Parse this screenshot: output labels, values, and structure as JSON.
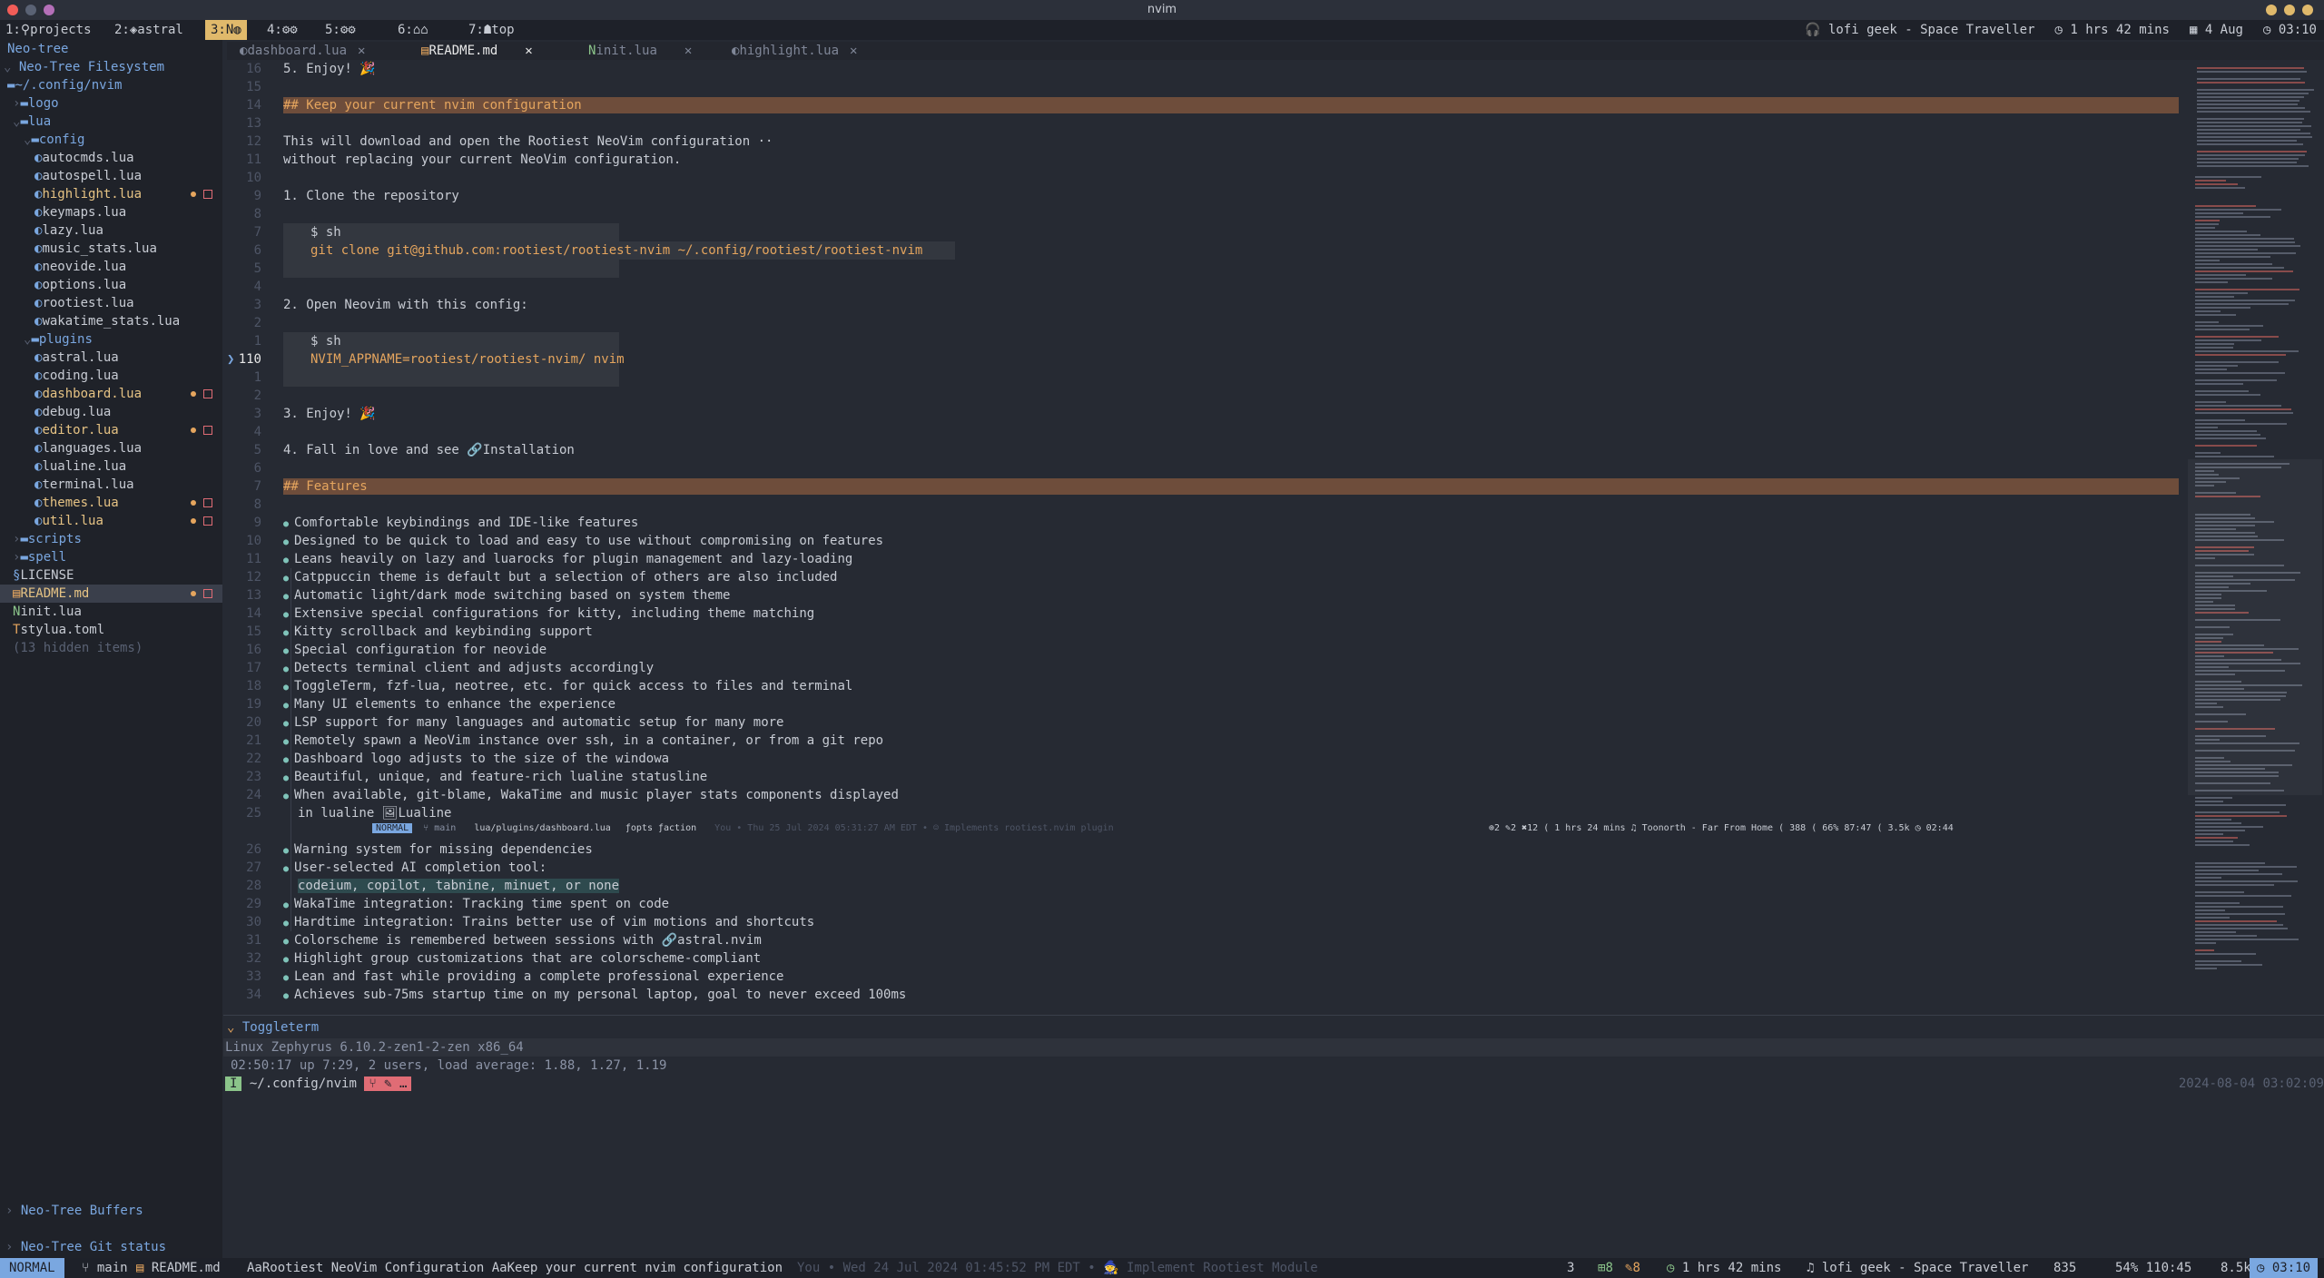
{
  "window": {
    "title": "nvim"
  },
  "workspaces": [
    {
      "label": "1:⚲projects",
      "active": false
    },
    {
      "label": "2:◈astral",
      "active": false
    },
    {
      "label": "3:N◍",
      "active": true
    },
    {
      "label": "4:⚙⚙",
      "active": false
    },
    {
      "label": "5:⚙⚙",
      "active": false
    },
    {
      "label": "6:⌂⌂",
      "active": false
    },
    {
      "label": "7:☗top",
      "active": false
    }
  ],
  "topright": {
    "music": "lofi geek - Space Traveller",
    "timer": "1 hrs 42 mins",
    "date": "4 Aug",
    "time": "03:10"
  },
  "neotree": {
    "header": "Neo-tree",
    "title": "Neo-Tree Filesystem",
    "root": "~/.config/nvim",
    "items": [
      {
        "label": "logo",
        "kind": "folder",
        "indent": 1,
        "open": false
      },
      {
        "label": "lua",
        "kind": "folder",
        "indent": 1,
        "open": true
      },
      {
        "label": "config",
        "kind": "folder",
        "indent": 2,
        "open": true
      },
      {
        "label": "autocmds.lua",
        "kind": "lua",
        "indent": 3
      },
      {
        "label": "autospell.lua",
        "kind": "lua",
        "indent": 3
      },
      {
        "label": "highlight.lua",
        "kind": "lua",
        "indent": 3,
        "modified": true
      },
      {
        "label": "keymaps.lua",
        "kind": "lua",
        "indent": 3
      },
      {
        "label": "lazy.lua",
        "kind": "lua",
        "indent": 3
      },
      {
        "label": "music_stats.lua",
        "kind": "lua",
        "indent": 3
      },
      {
        "label": "neovide.lua",
        "kind": "lua",
        "indent": 3
      },
      {
        "label": "options.lua",
        "kind": "lua",
        "indent": 3
      },
      {
        "label": "rootiest.lua",
        "kind": "lua",
        "indent": 3
      },
      {
        "label": "wakatime_stats.lua",
        "kind": "lua",
        "indent": 3
      },
      {
        "label": "plugins",
        "kind": "folder",
        "indent": 2,
        "open": true
      },
      {
        "label": "astral.lua",
        "kind": "lua",
        "indent": 3
      },
      {
        "label": "coding.lua",
        "kind": "lua",
        "indent": 3
      },
      {
        "label": "dashboard.lua",
        "kind": "lua",
        "indent": 3,
        "modified": true
      },
      {
        "label": "debug.lua",
        "kind": "lua",
        "indent": 3
      },
      {
        "label": "editor.lua",
        "kind": "lua",
        "indent": 3,
        "modified": true
      },
      {
        "label": "languages.lua",
        "kind": "lua",
        "indent": 3
      },
      {
        "label": "lualine.lua",
        "kind": "lua",
        "indent": 3
      },
      {
        "label": "terminal.lua",
        "kind": "lua",
        "indent": 3
      },
      {
        "label": "themes.lua",
        "kind": "lua",
        "indent": 3,
        "modified": true
      },
      {
        "label": "util.lua",
        "kind": "lua",
        "indent": 3,
        "modified": true
      },
      {
        "label": "scripts",
        "kind": "folder",
        "indent": 1,
        "open": false
      },
      {
        "label": "spell",
        "kind": "folder",
        "indent": 1,
        "open": false
      },
      {
        "label": "LICENSE",
        "kind": "file",
        "indent": 1
      },
      {
        "label": "README.md",
        "kind": "md",
        "indent": 1,
        "modified": true,
        "selected": true
      },
      {
        "label": "init.lua",
        "kind": "nvim",
        "indent": 1
      },
      {
        "label": "stylua.toml",
        "kind": "toml",
        "indent": 1
      },
      {
        "label": "(13 hidden items)",
        "kind": "hidden",
        "indent": 1
      }
    ],
    "buffers": "Neo-Tree Buffers",
    "git": "Neo-Tree Git status"
  },
  "tabs": [
    {
      "label": "dashboard.lua",
      "active": false
    },
    {
      "label": "README.md",
      "active": true
    },
    {
      "label": "init.lua",
      "active": false
    },
    {
      "label": "highlight.lua",
      "active": false
    }
  ],
  "editor": {
    "lines": [
      {
        "n": "16",
        "text": "5. Enjoy! 🎉"
      },
      {
        "n": "15",
        "text": ""
      },
      {
        "n": "14",
        "text": "## Keep your current nvim configuration",
        "heading": true
      },
      {
        "n": "13",
        "text": ""
      },
      {
        "n": "12",
        "text": "This will download and open the Rootiest NeoVim configuration ··"
      },
      {
        "n": "11",
        "text": "without replacing your current NeoVim configuration."
      },
      {
        "n": "10",
        "text": ""
      },
      {
        "n": "9",
        "text": "1. Clone the repository"
      },
      {
        "n": "8",
        "text": ""
      },
      {
        "n": "7",
        "text": "  $ sh",
        "code": true
      },
      {
        "n": "6",
        "text": "git clone git@github.com:rootiest/rootiest-nvim ~/.config/rootiest/rootiest-nvim",
        "code": true,
        "orange": true
      },
      {
        "n": "5",
        "text": "",
        "code": true
      },
      {
        "n": "4",
        "text": ""
      },
      {
        "n": "3",
        "text": "2. Open Neovim with this config:"
      },
      {
        "n": "2",
        "text": ""
      },
      {
        "n": "1",
        "text": "  $ sh",
        "code": true
      },
      {
        "n": "110",
        "text": "NVIM_APPNAME=rootiest/rootiest-nvim/ nvim",
        "code": true,
        "orange": true,
        "current": true
      },
      {
        "n": "1",
        "text": "",
        "code": true
      },
      {
        "n": "2",
        "text": ""
      },
      {
        "n": "3",
        "text": "3. Enjoy! 🎉"
      },
      {
        "n": "4",
        "text": ""
      },
      {
        "n": "5",
        "text": "4. Fall in love and see 🔗Installation"
      },
      {
        "n": "6",
        "text": ""
      },
      {
        "n": "7",
        "text": "## Features",
        "heading": true
      },
      {
        "n": "8",
        "text": ""
      },
      {
        "n": "9",
        "text": "Comfortable keybindings and IDE-like features",
        "bullet": true
      },
      {
        "n": "10",
        "text": "Designed to be quick to load and easy to use without compromising on features",
        "bullet": true
      },
      {
        "n": "11",
        "text": "Leans heavily on lazy and luarocks for plugin management and lazy-loading",
        "bullet": true
      },
      {
        "n": "12",
        "text": "Catppuccin theme is default but a selection of others are also included",
        "bullet": true
      },
      {
        "n": "13",
        "text": "Automatic light/dark mode switching based on system theme",
        "bullet": true
      },
      {
        "n": "14",
        "text": "Extensive special configurations for kitty, including theme matching",
        "bullet": true
      },
      {
        "n": "15",
        "text": "Kitty scrollback and keybinding support",
        "bullet": true
      },
      {
        "n": "16",
        "text": "Special configuration for neovide",
        "bullet": true
      },
      {
        "n": "17",
        "text": "Detects terminal client and adjusts accordingly",
        "bullet": true
      },
      {
        "n": "18",
        "text": "ToggleTerm, fzf-lua, neotree, etc. for quick access to files and terminal",
        "bullet": true
      },
      {
        "n": "19",
        "text": "Many UI elements to enhance the experience",
        "bullet": true
      },
      {
        "n": "20",
        "text": "LSP support for many languages and automatic setup for many more",
        "bullet": true
      },
      {
        "n": "21",
        "text": "Remotely spawn a NeoVim instance over ssh, in a container, or from a git repo",
        "bullet": true
      },
      {
        "n": "22",
        "text": "Dashboard logo adjusts to the size of the windowa",
        "bullet": true
      },
      {
        "n": "23",
        "text": "Beautiful, unique, and feature-rich lualine statusline",
        "bullet": true
      },
      {
        "n": "24",
        "text": "When available, git-blame, WakaTime and music player stats components displayed",
        "bullet": true
      },
      {
        "n": "25",
        "text": "in lualine 🖼Lualine",
        "cont": true
      }
    ],
    "lines2": [
      {
        "n": "26",
        "text": "Warning system for missing dependencies",
        "bullet": true
      },
      {
        "n": "27",
        "text": "User-selected AI completion tool:",
        "bullet": true
      },
      {
        "n": "28",
        "text": "codeium, copilot, tabnine, minuet, or none",
        "cont": true,
        "tags": true
      },
      {
        "n": "29",
        "text": "WakaTime integration: Tracking time spent on code",
        "bullet": true
      },
      {
        "n": "30",
        "text": "Hardtime integration: Trains better use of vim motions and shortcuts",
        "bullet": true
      },
      {
        "n": "31",
        "text": "Colorscheme is remembered between sessions with 🔗astral.nvim",
        "bullet": true
      },
      {
        "n": "32",
        "text": "Highlight group customizations that are colorscheme-compliant",
        "bullet": true
      },
      {
        "n": "33",
        "text": "Lean and fast while providing a complete professional experience",
        "bullet": true
      },
      {
        "n": "34",
        "text": "Achieves sub-75ms startup time on my personal laptop, goal to never exceed 100ms",
        "bullet": true
      }
    ],
    "inner_status": {
      "mode": "NORMAL",
      "branch": "main",
      "path": "lua/plugins/dashboard.lua",
      "crumbs": "ƒopts ƒaction",
      "blame": "You • Thu 25 Jul 2024 05:31:27 AM EDT • ☺ Implements rootiest.nvim plugin",
      "right": "⊕2 ✎2 ✖12 (  1 hrs 24 mins   ♫ Toonorth - Far From Home (  388 (  66%  87:47 (  3.5k  ◷ 02:44"
    }
  },
  "terminal": {
    "title": "Toggleterm",
    "l1": "Linux Zephyrus 6.10.2-zen1-2-zen x86_64",
    "l2": "02:50:17 up  7:29,  2 users,  load average: 1.88, 1.27, 1.19",
    "prompt_mode": "I",
    "prompt_path": "~/.config/nvim",
    "prompt_git": "⑂ ✎ …",
    "right": "2024-08-04 03:02:09"
  },
  "status": {
    "mode": "NORMAL",
    "branch": "main",
    "file": "README.md",
    "crumb1": "AaRootiest NeoVim Configuration",
    "crumb2": "AaKeep your current nvim configuration",
    "blame": "You • Wed 24 Jul 2024 01:45:52 PM EDT • 🧙 Implement Rootiest Module",
    "diag": "3",
    "added": "8",
    "changed": "8",
    "waka": "1 hrs 42 mins",
    "music": "lofi geek - Space Traveller",
    "words": "835",
    "pos": "54% 110:45",
    "size": "8.5k",
    "clock": "03:10"
  },
  "colors": {
    "accent": "#e0b96b",
    "mode": "#7aa7e0",
    "heading_band": "#6e4d3b",
    "alert": "#e06c75"
  }
}
